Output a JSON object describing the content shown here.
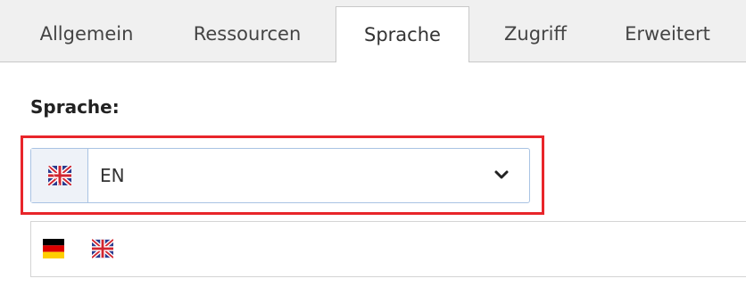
{
  "tabs": [
    {
      "label": "Allgemein",
      "active": false
    },
    {
      "label": "Ressourcen",
      "active": false
    },
    {
      "label": "Sprache",
      "active": true
    },
    {
      "label": "Zugriff",
      "active": false
    },
    {
      "label": "Erweitert",
      "active": false
    }
  ],
  "language_field": {
    "label": "Sprache:",
    "selected_value": "EN",
    "selected_flag_icon": "flag-uk-icon",
    "highlight_color": "#e8252a"
  },
  "flag_options": [
    {
      "icon": "flag-de-icon"
    },
    {
      "icon": "flag-uk-icon"
    }
  ]
}
